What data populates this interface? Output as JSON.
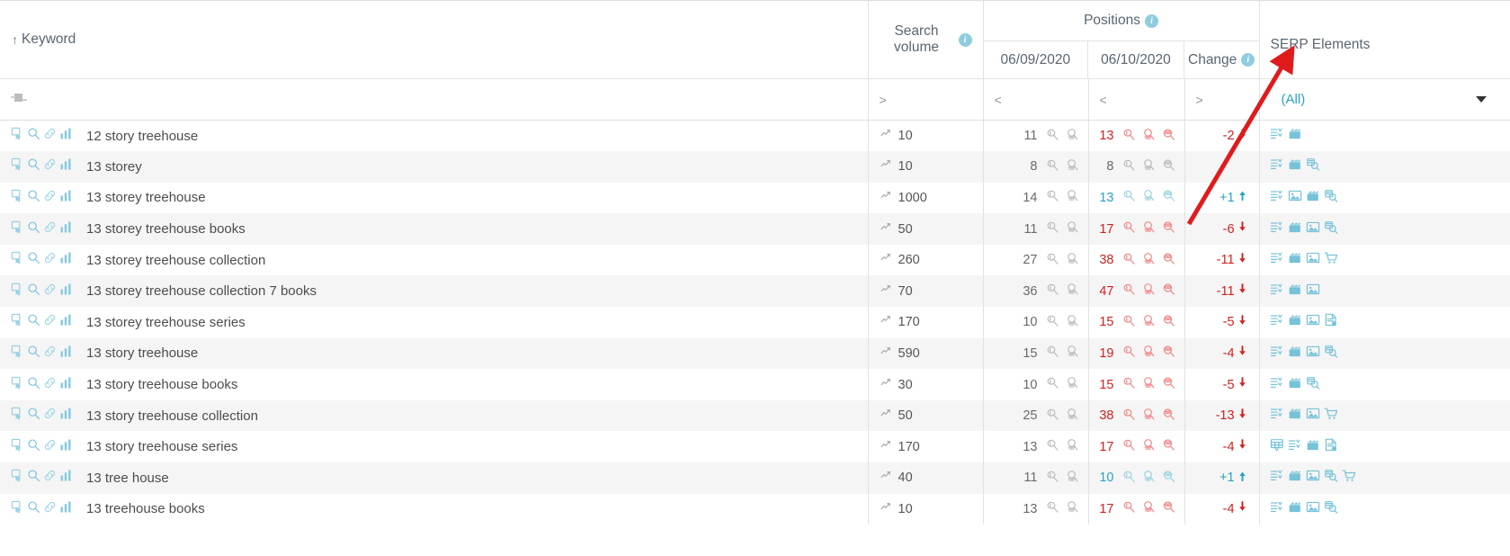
{
  "header": {
    "keyword_col": "Keyword",
    "sort_indicator": "↑",
    "search_volume": "Search volume",
    "positions": "Positions",
    "date1": "06/09/2020",
    "date2": "06/10/2020",
    "change": "Change",
    "serp_elements": "SERP Elements"
  },
  "filters": {
    "keyword_filter_icon": "abc-filter-icon",
    "search_volume_op": ">",
    "date1_op": "<",
    "date2_op": "<",
    "change_op": ">",
    "serp_value": "(All)",
    "dropdown_icon": "chevron-down-icon"
  },
  "rows": [
    {
      "keyword": "12 story treehouse",
      "volume": "10",
      "pos1": "11",
      "pos2": "13",
      "pos2_state": "down",
      "change": "-2",
      "change_dir": "down",
      "serp": [
        "snippet",
        "video"
      ]
    },
    {
      "keyword": "13 storey",
      "volume": "10",
      "pos1": "8",
      "pos2": "8",
      "pos2_state": "same",
      "change": "",
      "change_dir": "none",
      "serp": [
        "snippet",
        "video",
        "preview"
      ]
    },
    {
      "keyword": "13 storey treehouse",
      "volume": "1000",
      "pos1": "14",
      "pos2": "13",
      "pos2_state": "up",
      "change": "+1",
      "change_dir": "up",
      "serp": [
        "snippet",
        "image",
        "video",
        "preview"
      ]
    },
    {
      "keyword": "13 storey treehouse books",
      "volume": "50",
      "pos1": "11",
      "pos2": "17",
      "pos2_state": "down",
      "change": "-6",
      "change_dir": "down",
      "serp": [
        "snippet",
        "video",
        "image",
        "preview"
      ]
    },
    {
      "keyword": "13 storey treehouse collection",
      "volume": "260",
      "pos1": "27",
      "pos2": "38",
      "pos2_state": "down",
      "change": "-11",
      "change_dir": "down",
      "serp": [
        "snippet",
        "video",
        "image",
        "shopping"
      ]
    },
    {
      "keyword": "13 storey treehouse collection 7 books",
      "volume": "70",
      "pos1": "36",
      "pos2": "47",
      "pos2_state": "down",
      "change": "-11",
      "change_dir": "down",
      "serp": [
        "snippet",
        "video",
        "image"
      ]
    },
    {
      "keyword": "13 storey treehouse series",
      "volume": "170",
      "pos1": "10",
      "pos2": "15",
      "pos2_state": "down",
      "change": "-5",
      "change_dir": "down",
      "serp": [
        "snippet",
        "video",
        "image",
        "document"
      ]
    },
    {
      "keyword": "13 story treehouse",
      "volume": "590",
      "pos1": "15",
      "pos2": "19",
      "pos2_state": "down",
      "change": "-4",
      "change_dir": "down",
      "serp": [
        "snippet",
        "video",
        "image",
        "preview"
      ]
    },
    {
      "keyword": "13 story treehouse books",
      "volume": "30",
      "pos1": "10",
      "pos2": "15",
      "pos2_state": "down",
      "change": "-5",
      "change_dir": "down",
      "serp": [
        "snippet",
        "video",
        "preview"
      ]
    },
    {
      "keyword": "13 story treehouse collection",
      "volume": "50",
      "pos1": "25",
      "pos2": "38",
      "pos2_state": "down",
      "change": "-13",
      "change_dir": "down",
      "serp": [
        "snippet",
        "video",
        "image",
        "shopping"
      ]
    },
    {
      "keyword": "13 story treehouse series",
      "volume": "170",
      "pos1": "13",
      "pos2": "17",
      "pos2_state": "down",
      "change": "-4",
      "change_dir": "down",
      "serp": [
        "table",
        "snippet",
        "video",
        "document"
      ]
    },
    {
      "keyword": "13 tree house",
      "volume": "40",
      "pos1": "11",
      "pos2": "10",
      "pos2_state": "up",
      "change": "+1",
      "change_dir": "up",
      "serp": [
        "snippet",
        "video",
        "image",
        "preview",
        "shopping"
      ]
    },
    {
      "keyword": "13 treehouse books",
      "volume": "10",
      "pos1": "13",
      "pos2": "17",
      "pos2_state": "down",
      "change": "-4",
      "change_dir": "down",
      "serp": [
        "snippet",
        "video",
        "image",
        "preview"
      ]
    }
  ],
  "colors": {
    "accent_blue": "#2aa3c4",
    "negative_red": "#d22121",
    "icon_blue": "#77c2d8",
    "text_gray": "#4d4d4d",
    "annotation_red": "#e01b1b"
  },
  "annotation": {
    "type": "arrow",
    "points_to": "SERP Elements"
  }
}
